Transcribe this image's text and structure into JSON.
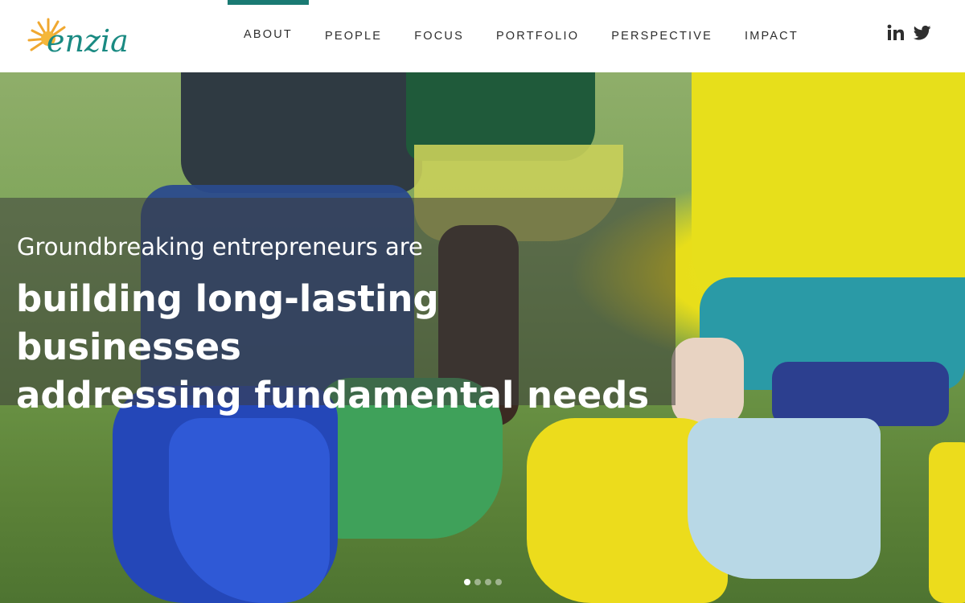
{
  "header": {
    "logo_text": "enzia",
    "nav": [
      {
        "label": "ABOUT",
        "active": true
      },
      {
        "label": "PEOPLE",
        "active": false
      },
      {
        "label": "FOCUS",
        "active": false
      },
      {
        "label": "PORTFOLIO",
        "active": false
      },
      {
        "label": "PERSPECTIVE",
        "active": false
      },
      {
        "label": "IMPACT",
        "active": false
      }
    ],
    "social": [
      {
        "icon": "linkedin-icon"
      },
      {
        "icon": "twitter-icon"
      }
    ]
  },
  "hero": {
    "subtitle": "Groundbreaking entrepreneurs are",
    "title_line1": "building long-lasting businesses",
    "title_line2": "addressing fundamental needs",
    "slides_total": 4,
    "active_slide": 1
  },
  "colors": {
    "accent": "#1a7a73",
    "logo": "#1a8a82",
    "sun": "#f0a830"
  }
}
